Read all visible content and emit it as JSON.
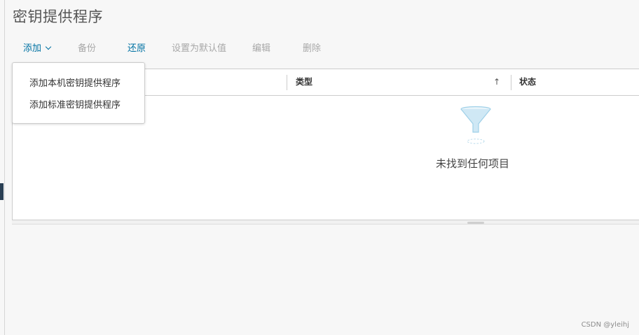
{
  "page": {
    "title": "密钥提供程序"
  },
  "toolbar": {
    "add": "添加",
    "backup": "备份",
    "restore": "还原",
    "set_default": "设置为默认值",
    "edit": "编辑",
    "delete": "删除"
  },
  "add_menu": {
    "items": [
      "添加本机密钥提供程序",
      "添加标准密钥提供程序"
    ]
  },
  "grid": {
    "columns": [
      "",
      "类型",
      "状态"
    ],
    "sort_indicator": "↑",
    "empty_message": "未找到任何项目"
  },
  "watermark": "CSDN @yleihj",
  "colors": {
    "link": "#0072a3",
    "disabled": "#a8a8a8",
    "nav_marker": "#2a3f54"
  }
}
